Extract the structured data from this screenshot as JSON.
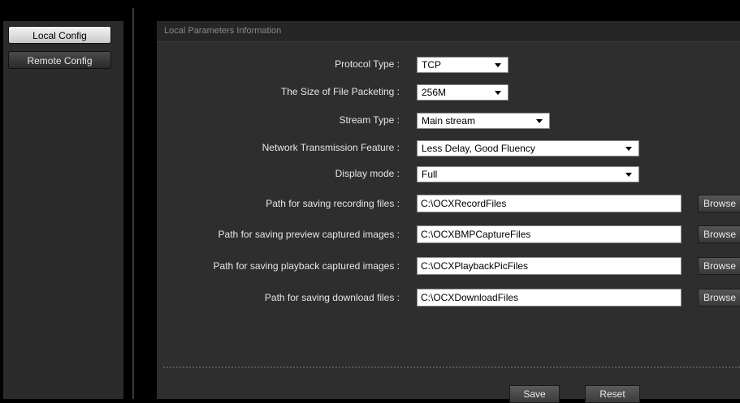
{
  "sidebar": {
    "items": [
      {
        "label": "Local Config",
        "active": true
      },
      {
        "label": "Remote Config",
        "active": false
      }
    ]
  },
  "panel": {
    "title": "Local Parameters Information"
  },
  "form": {
    "protocol_type": {
      "label": "Protocol Type :",
      "value": "TCP"
    },
    "file_packet_size": {
      "label": "The Size of File Packeting :",
      "value": "256M"
    },
    "stream_type": {
      "label": "Stream Type :",
      "value": "Main stream"
    },
    "network_feature": {
      "label": "Network Transmission Feature :",
      "value": "Less Delay, Good Fluency"
    },
    "display_mode": {
      "label": "Display mode :",
      "value": "Full"
    },
    "record_path": {
      "label": "Path for saving recording files :",
      "value": "C:\\OCXRecordFiles",
      "button": "Browse"
    },
    "preview_capture_path": {
      "label": "Path for saving preview captured images :",
      "value": "C:\\OCXBMPCaptureFiles",
      "button": "Browse"
    },
    "playback_capture_path": {
      "label": "Path for saving playback captured images :",
      "value": "C:\\OCXPlaybackPicFiles",
      "button": "Browse"
    },
    "download_path": {
      "label": "Path for saving download files :",
      "value": "C:\\OCXDownloadFiles",
      "button": "Browse"
    }
  },
  "actions": {
    "save_label": "Save",
    "reset_label": "Reset"
  },
  "colors": {
    "background": "#000000",
    "panel": "#2e2e2e",
    "text": "#e6e6e6"
  }
}
